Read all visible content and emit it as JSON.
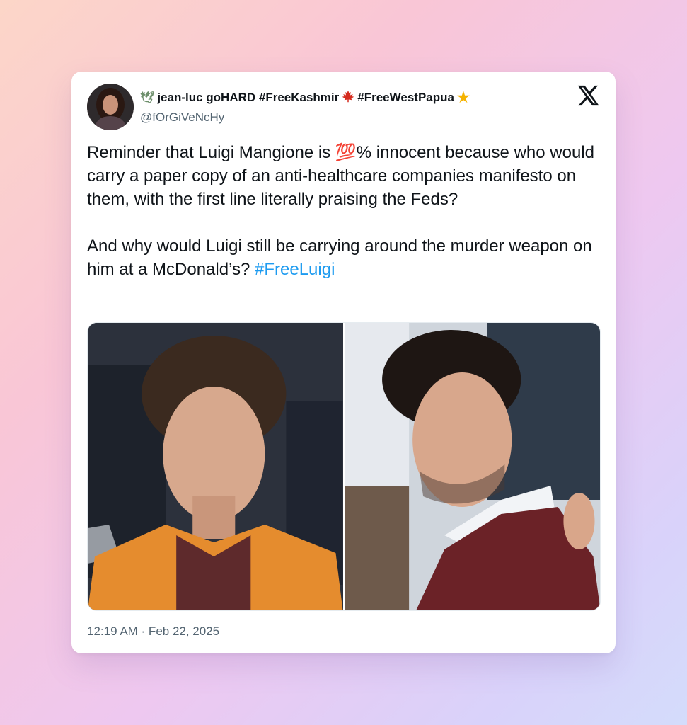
{
  "author": {
    "display_name_prefix": "jean-luc goHARD #FreeKashmir",
    "display_name_suffix": "#FreeWestPapua",
    "handle": "@fOrGiVeNcHy",
    "avatar_icon": "profile-photo"
  },
  "tweet": {
    "line1_before": "Reminder that Luigi Mangione is ",
    "line1_emoji": "💯",
    "line1_after": "% innocent because who would carry a paper copy of an anti-healthcare companies manifesto on them, with the first line literally praising the Feds?",
    "para2": "And why would Luigi still be carrying around the murder weapon on him at a McDonald’s? ",
    "hashtag": "#FreeLuigi",
    "timestamp": "12:19 AM · Feb 22, 2025"
  },
  "icons": {
    "dove": "dove-icon",
    "maple_leaf": "maple-leaf-icon",
    "star": "star-icon",
    "platform": "x-logo-icon"
  },
  "colors": {
    "text": "#0f1419",
    "muted": "#536471",
    "link": "#1d9bf0"
  }
}
